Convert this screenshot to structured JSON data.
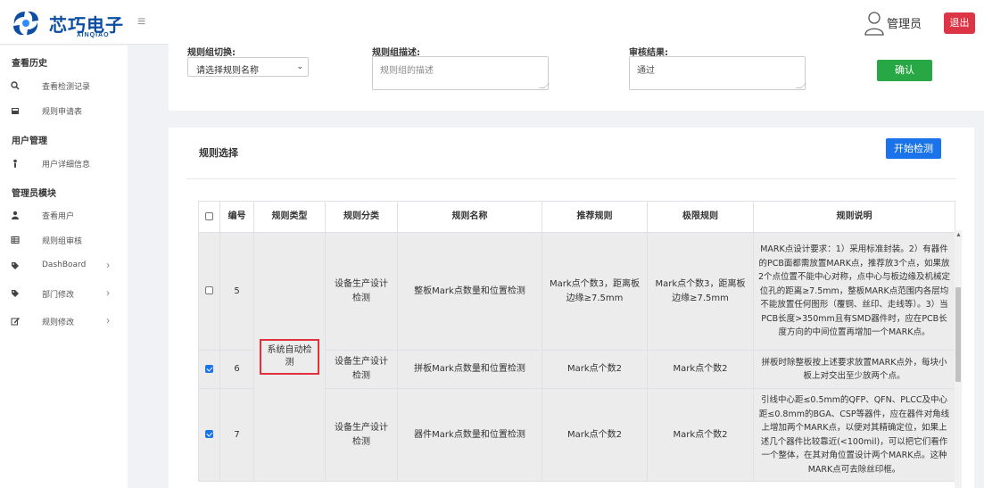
{
  "app": {
    "logo_text": "芯巧电子",
    "logo_sub": "XINQIAO",
    "user_name": "管理员",
    "logout_label": "退出"
  },
  "sidebar": {
    "sections": [
      {
        "title": "查看历史",
        "items": [
          {
            "label": "查看检测记录",
            "icon": "search-icon"
          },
          {
            "label": "规则申请表",
            "icon": "inbox-icon"
          }
        ]
      },
      {
        "title": "用户管理",
        "items": [
          {
            "label": "用户详细信息",
            "icon": "user-detail-icon"
          }
        ]
      },
      {
        "title": "管理员模块",
        "items": [
          {
            "label": "查看用户",
            "icon": "user-icon"
          },
          {
            "label": "规则组审核",
            "icon": "table-icon"
          },
          {
            "label": "DashBoard",
            "icon": "tag-icon",
            "expandable": true
          },
          {
            "label": "部门修改",
            "icon": "tag-icon",
            "expandable": true
          },
          {
            "label": "规则修改",
            "icon": "edit-icon",
            "expandable": true
          }
        ]
      }
    ]
  },
  "form": {
    "group_switch_label": "规则组切换:",
    "group_select_value": "请选择规则名称",
    "group_desc_label": "规则组描述:",
    "group_desc_placeholder": "规则组的描述",
    "review_label": "审核结果:",
    "review_value": "通过",
    "confirm_label": "确认"
  },
  "rules": {
    "title": "规则选择",
    "start_label": "开始检测",
    "columns": [
      "编号",
      "规则类型",
      "规则分类",
      "规则名称",
      "推荐规则",
      "极限规则",
      "规则说明"
    ],
    "type_value": "系统自动检测",
    "rows": [
      {
        "checked": false,
        "id": "5",
        "category": "设备生产设计检测",
        "name": "整板Mark点数量和位置检测",
        "recommended": "Mark点个数3，距离板边缘≥7.5mm",
        "limit": "Mark点个数3，距离板边缘≥7.5mm",
        "desc": "MARK点设计要求：1）采用标准封装。2）有器件的PCB面都需放置MARK点，推荐放3个点，如果放2个点位置不能中心对称，点中心与板边缘及机械定位孔的距离≥7.5mm，整板MARK点范围内各层均不能放置任何图形（覆铜、丝印、走线等）。3）当PCB长度>350mm且有SMD器件时，应在PCB长度方向的中间位置再增加一个MARK点。"
      },
      {
        "checked": true,
        "id": "6",
        "category": "设备生产设计检测",
        "name": "拼板Mark点数量和位置检测",
        "recommended": "Mark点个数2",
        "limit": "Mark点个数2",
        "desc": "拼板时除整板按上述要求放置MARK点外，每块小板上对交出至少放两个点。"
      },
      {
        "checked": true,
        "id": "7",
        "category": "设备生产设计检测",
        "name": "器件Mark点数量和位置检测",
        "recommended": "Mark点个数2",
        "limit": "Mark点个数2",
        "desc": "引线中心距≤0.5mm的QFP、QFN、PLCC及中心距≤0.8mm的BGA、CSP等器件，应在器件对角线上增加两个MARK点，以便对其精确定位，如果上述几个器件比较靠近(<100mil)，可以把它们看作一个整体，在其对角位置设计两个MARK点。这种MARK点可去除丝印框。"
      }
    ]
  },
  "colors": {
    "brand": "#0b4ea2",
    "confirm": "#28a745",
    "primary": "#1a73e8",
    "danger": "#dc3545",
    "highlight": "#e0313d"
  }
}
